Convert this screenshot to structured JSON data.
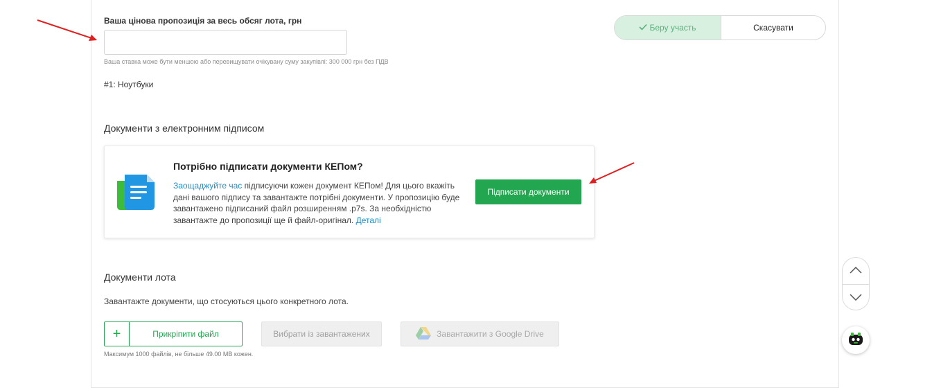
{
  "bid": {
    "label": "Ваша цінова пропозиція за весь обсяг лота, грн",
    "value": "",
    "hint": "Ваша ставка може бути меншою або перевищувати очікувану суму закупівлі: 300 000 грн без ПДВ"
  },
  "lot": {
    "name": "#1: Ноутбуки"
  },
  "participation": {
    "participate_label": "Беру участь",
    "cancel_label": "Скасувати"
  },
  "signature_section": {
    "title": "Документи з електронним підписом",
    "card_title": "Потрібно підписати документи КЕПом?",
    "link_start": "Заощаджуйте час",
    "text": " підписуючи кожен документ КЕПом! Для цього вкажіть дані вашого підпису та завантажте потрібні документи. У пропозицію буде завантажено підписаний файл розширенням .p7s. За необхідністю завантажте до пропозиції ще й файл-оригінал. ",
    "link_end": "Деталі",
    "sign_button": "Підписати документи"
  },
  "lot_documents": {
    "title": "Документи лота",
    "description": "Завантажте документи, що стосуються цього конкретного лота.",
    "attach_button": "Прикріпити файл",
    "choose_button": "Вибрати із завантажених",
    "gdrive_button": "Завантажити з Google Drive",
    "limits_hint": "Максимум 1000 файлів, не більше 49.00 MB кожен."
  },
  "icons": {
    "check": "check-icon",
    "document": "document-icon",
    "plus": "plus-icon",
    "google_drive": "google-drive-icon",
    "chevron_up": "chevron-up-icon",
    "chevron_down": "chevron-down-icon",
    "bot": "bot-icon"
  },
  "colors": {
    "accent_green": "#23a650",
    "link_blue": "#1b8fc9",
    "participate_bg": "#d7f0e0"
  }
}
